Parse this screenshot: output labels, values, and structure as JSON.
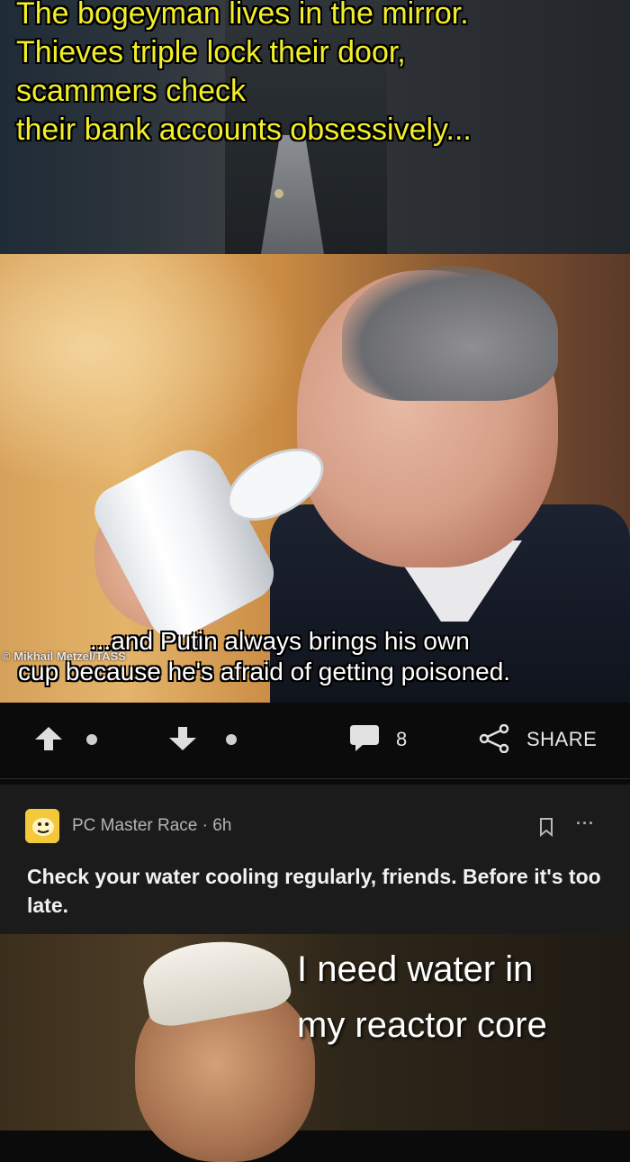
{
  "meme": {
    "caption_top": "The bogeyman lives in the mirror.\nThieves triple lock their door,\nscammers check\ntheir bank accounts obsessively...",
    "caption_mid_line1": "...and Putin always brings his own",
    "caption_mid_line2": "cup because he's afraid of getting poisoned.",
    "photo_credit": "© Mikhail Metzel/TASS"
  },
  "actions": {
    "upvote_icon": "arrow-up-icon",
    "downvote_icon": "arrow-down-icon",
    "comment_icon": "comment-bubble-icon",
    "comment_count": "8",
    "share_icon": "share-icon",
    "share_label": "SHARE"
  },
  "next_post": {
    "community": "PC Master Race · 6h",
    "avatar_icon": "pcmr-avatar-icon",
    "avatar_color": "#f3c83a",
    "title": "Check your water cooling regularly, friends. Before it's too late.",
    "bookmark_icon": "bookmark-icon",
    "more_label": "···",
    "meme_caption": "I need water in\nmy reactor core"
  },
  "colors": {
    "background": "#0b0b0b",
    "card": "#1b1b1b",
    "caption_yellow": "#f3ee2a"
  }
}
